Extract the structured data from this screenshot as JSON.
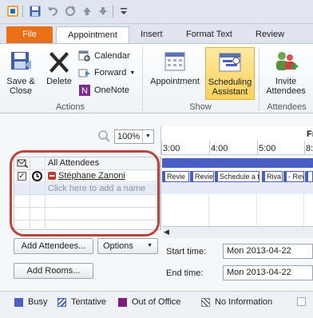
{
  "tabs": {
    "file": "File",
    "appointment": "Appointment",
    "insert": "Insert",
    "format_text": "Format Text",
    "review": "Review"
  },
  "ribbon": {
    "save_close": [
      "Save &",
      "Close"
    ],
    "delete": "Delete",
    "calendar": "Calendar",
    "forward": "Forward",
    "onenote": "OneNote",
    "actions_group": "Actions",
    "appointment_view": "Appointment",
    "scheduling": [
      "Scheduling",
      "Assistant"
    ],
    "show_group": "Show",
    "invite": [
      "Invite",
      "Attendees"
    ],
    "attendees_group": "Attendees"
  },
  "zoom": {
    "value": "100%"
  },
  "timeline": {
    "day_label": "Fr",
    "hours": [
      "3:00",
      "4:00",
      "5:00",
      "8:"
    ],
    "busy_blocks": [
      "Revie",
      "Revie",
      "Schedule a te",
      "Riva",
      "- Revie"
    ]
  },
  "grid": {
    "header": "All Attendees",
    "attendee": "Stéphane Zanoni",
    "add_placeholder": "Click here to add a name"
  },
  "buttons": {
    "add_attendees": "Add Attendees...",
    "options": "Options",
    "add_rooms": "Add Rooms..."
  },
  "times": {
    "start_label": "Start time:",
    "start_value": "Mon 2013-04-22",
    "end_label": "End time:",
    "end_value": "Mon 2013-04-22"
  },
  "legend": {
    "busy": "Busy",
    "tentative": "Tentative",
    "out_of_office": "Out of Office",
    "no_info": "No Information"
  },
  "colors": {
    "busy": "#4a5fc1",
    "out_of_office": "#7b1f7e",
    "file_tab": "#ea6f16",
    "highlight": "#b8463c"
  }
}
